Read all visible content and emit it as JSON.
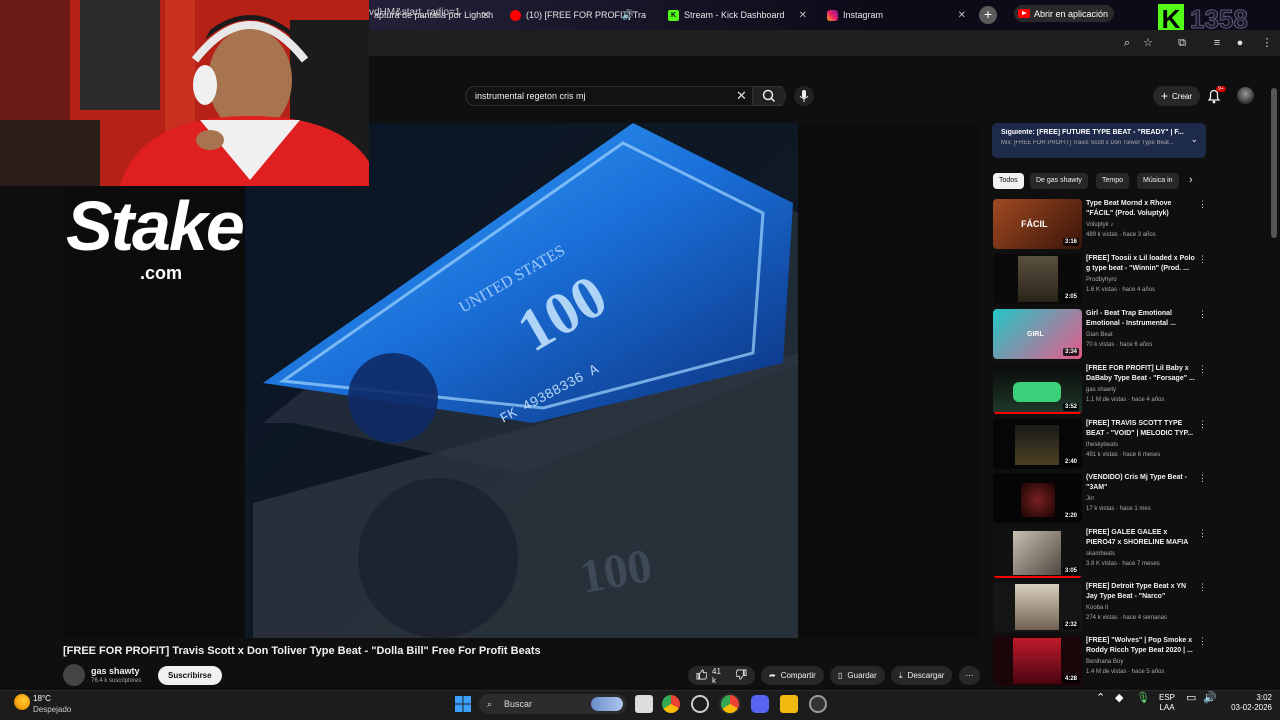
{
  "browser": {
    "tabs": [
      {
        "label": "aptura de pantalla por Lightsh",
        "icon": "lightshot-icon"
      },
      {
        "label": "(10) [FREE FOR PROFIT] Tra",
        "icon": "youtube-icon"
      },
      {
        "label": "Stream - Kick Dashboard",
        "icon": "kick-icon"
      },
      {
        "label": "Instagram",
        "icon": "instagram-icon"
      }
    ],
    "address": "vdHM&start_radio=1",
    "open_in_app": "Abrir en aplicación"
  },
  "overlay": {
    "kick_count": "1358",
    "sponsor": "Stake",
    "sponsor_suffix": ".com"
  },
  "youtube": {
    "search_value": "instrumental regeton cris mj",
    "create_label": "Crear",
    "notif_count": "9+",
    "video_title": "[FREE FOR PROFIT] Travis Scott x Don Toliver Type Beat - \"Dolla Bill\" Free For Profit Beats",
    "channel": "gas shawty",
    "subscribers": "76.4 k suscriptores",
    "subscribe_label": "Suscribirse",
    "likes": "41 k",
    "share_label": "Compartir",
    "save_label": "Guardar",
    "download_label": "Descargar",
    "up_next_title": "Siguiente: [FREE] FUTURE TYPE BEAT - \"READY\" | F...",
    "up_next_sub": "Mix: [FREE FOR PROFIT] Travis Scott x Don Toliver Type Beat...",
    "chips": [
      "Todos",
      "De gas shawty",
      "Tempo",
      "Música in"
    ],
    "recommendations": [
      {
        "title": "Type Beat Mornd x Rhove \"FÁCIL\" (Prod. Voluptyk)",
        "channel": "Voluptyk ♪",
        "meta": "489 k vistas · hace 3 años",
        "duration": "3:16",
        "thumb_text": "FÁCIL"
      },
      {
        "title": "[FREE] Toosii x Lil loaded x Polo g type beat - \"Winnin\" (Prod. ...",
        "channel": "Prodbyhyro",
        "meta": "1.6 K vistas · hace 4 años",
        "duration": "2:05",
        "thumb_text": ""
      },
      {
        "title": "Girl - Beat Trap Emotional Emotional - Instrumental ...",
        "channel": "Gian Beat",
        "meta": "70 k vistas · hace 6 años",
        "duration": "3:34",
        "thumb_text": "GIRL"
      },
      {
        "title": "[FREE FOR PROFIT] Lil Baby x DaBaby Type Beat - \"Forsage\" ...",
        "channel": "gas shawty",
        "meta": "1.1 M de vistas · hace 4 años",
        "duration": "3:52",
        "thumb_text": ""
      },
      {
        "title": "[FREE] TRAVIS SCOTT TYPE BEAT - \"VOID\" | MELODIC TYP...",
        "channel": "theskybeats",
        "meta": "491 k vistas · hace 6 meses",
        "duration": "2:40",
        "thumb_text": ""
      },
      {
        "title": "(VENDIDO) Cris Mj Type Beat - \"3AM\"",
        "channel": "Jirr",
        "meta": "17 k vistas · hace 1 mes",
        "duration": "2:20",
        "thumb_text": ""
      },
      {
        "title": "[FREE] GALEE GALEE x PIERO47 x SHORELINE MAFIA TYPE ...",
        "channel": "skambeats",
        "meta": "3.8 K vistas · hace 7 meses",
        "duration": "3:05",
        "thumb_text": ""
      },
      {
        "title": "[FREE] Detroit Type Beat x YN Jay Type Beat - \"Narco\"",
        "channel": "Kooba II",
        "meta": "274 k vistas · hace 4 semanas",
        "duration": "2:32",
        "thumb_text": ""
      },
      {
        "title": "[FREE] \"Wolves\" | Pop Smoke x Roddy Ricch Type Beat 2020 | ...",
        "channel": "Benihana Boy",
        "meta": "1.4 M de vistas · hace 5 años",
        "duration": "4:28",
        "thumb_text": ""
      }
    ]
  },
  "taskbar": {
    "temperature": "18°C",
    "weather": "Despejado",
    "search_label": "Buscar",
    "lang": "ESP",
    "layout": "LAA",
    "time": "3:02",
    "date": "03-02-2026"
  },
  "colors": {
    "youtube_red": "#ff0000",
    "kick_green": "#53fc18",
    "up_next_bg": "#1d2a4a"
  }
}
